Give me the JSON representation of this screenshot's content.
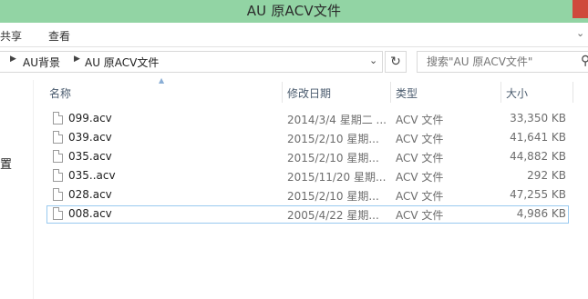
{
  "window": {
    "title": "AU 原ACV文件"
  },
  "ribbon": {
    "tabs": [
      "共享",
      "查看"
    ],
    "expand_icon": "chevron-down-icon"
  },
  "address": {
    "segments": [
      "AU背景",
      "AU 原ACV文件"
    ]
  },
  "search": {
    "placeholder": "搜索\"AU 原ACV文件\""
  },
  "navpane": {
    "visible_item": "置"
  },
  "columns": {
    "name": "名称",
    "date": "修改日期",
    "type": "类型",
    "size": "大小"
  },
  "files": [
    {
      "name": "099.acv",
      "date": "2014/3/4 星期二 ...",
      "type": "ACV 文件",
      "size": "33,350 KB"
    },
    {
      "name": "039.acv",
      "date": "2015/2/10 星期...",
      "type": "ACV 文件",
      "size": "41,641 KB"
    },
    {
      "name": "035.acv",
      "date": "2015/2/10 星期...",
      "type": "ACV 文件",
      "size": "44,882 KB"
    },
    {
      "name": "035..acv",
      "date": "2015/11/20 星期...",
      "type": "ACV 文件",
      "size": "292 KB"
    },
    {
      "name": "028.acv",
      "date": "2015/2/10 星期...",
      "type": "ACV 文件",
      "size": "47,255 KB"
    },
    {
      "name": "008.acv",
      "date": "2005/4/22 星期...",
      "type": "ACV 文件",
      "size": "4,986 KB",
      "selected": true
    }
  ],
  "colors": {
    "titlebar": "#92d4a4",
    "selection_border": "#99c9ef",
    "close": "#cf4a3c"
  }
}
